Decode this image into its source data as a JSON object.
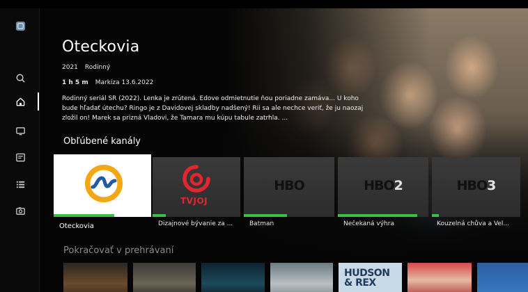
{
  "hero": {
    "title": "Oteckovia",
    "year": "2021",
    "genre": "Rodinný",
    "duration": "1 h 5 m",
    "broadcast": "Markíza  13.6.2022",
    "description": "Rodinný seriál SR (2022). Lenka je zrútená. Edove odmietnutie ňou poriadne zamáva... U koho bude hľadať útechu? Ringo je z Davidovej skladby nadšený! Rii sa ale nechce veriť, že ju naozaj zložil on! Marek sa prizná Vladovi, že Tamara mu kúpu tabule zatrhla. ..."
  },
  "sidebar": {
    "items": [
      {
        "name": "logo",
        "icon": "app-logo-icon"
      },
      {
        "name": "search",
        "icon": "search-icon"
      },
      {
        "name": "home",
        "icon": "home-icon",
        "active": true
      },
      {
        "name": "tv",
        "icon": "tv-icon"
      },
      {
        "name": "guide",
        "icon": "guide-icon"
      },
      {
        "name": "list",
        "icon": "list-icon"
      },
      {
        "name": "recordings",
        "icon": "camera-icon"
      }
    ]
  },
  "favorites": {
    "heading": "Obľúbené kanály",
    "channels": [
      {
        "logo": "Markíza",
        "program": "Oteckovia",
        "progress": 0.62,
        "focused": true
      },
      {
        "logo": "TV JOJ",
        "logo_text": "TVJOJ",
        "program": "Dizajnové bývanie za ...",
        "progress": 0.15
      },
      {
        "logo": "HBO",
        "logo_text": "HBO",
        "program": "Batman",
        "progress": 0.48
      },
      {
        "logo": "HBO2",
        "logo_text": "HBO",
        "logo_num": "2",
        "program": "Nečekaná výhra",
        "progress": 0.88
      },
      {
        "logo": "HBO3",
        "logo_text": "HBO",
        "logo_num": "3",
        "program": "Kouzelná chůva a Vel...",
        "progress": 0.08
      }
    ]
  },
  "continue": {
    "heading": "Pokračovať v prehrávaní",
    "items": [
      {
        "title": "HUDSON & REX",
        "text": "HUDSON\n& REX"
      }
    ]
  },
  "colors": {
    "progress": "#39c145",
    "joj_red": "#e3262d",
    "markiza_orange": "#f3a712",
    "markiza_blue": "#1f5aa6"
  }
}
